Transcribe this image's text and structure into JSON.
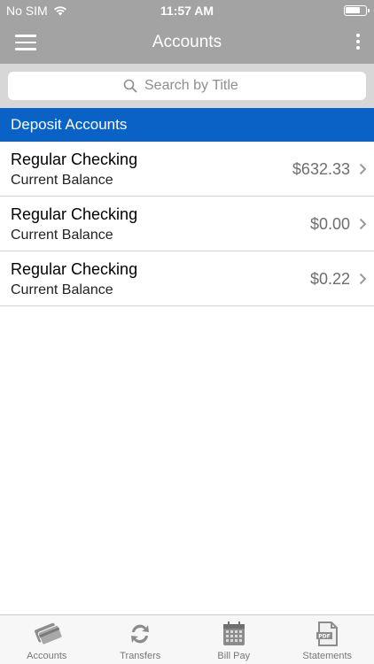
{
  "status_bar": {
    "carrier": "No SIM",
    "time": "11:57 AM"
  },
  "nav": {
    "title": "Accounts",
    "menu_icon": "hamburger-icon",
    "more_icon": "more-vertical-icon"
  },
  "search": {
    "placeholder": "Search by Title",
    "value": ""
  },
  "section": {
    "title": "Deposit Accounts"
  },
  "accounts": [
    {
      "name": "Regular Checking",
      "label": "Current Balance",
      "amount": "$632.33"
    },
    {
      "name": "Regular Checking",
      "label": "Current Balance",
      "amount": "$0.00"
    },
    {
      "name": "Regular Checking",
      "label": "Current Balance",
      "amount": "$0.22"
    }
  ],
  "tabs": [
    {
      "label": "Accounts",
      "icon": "cards-icon"
    },
    {
      "label": "Transfers",
      "icon": "transfer-arrows-icon"
    },
    {
      "label": "Bill Pay",
      "icon": "calendar-icon"
    },
    {
      "label": "Statements",
      "icon": "pdf-document-icon"
    }
  ],
  "colors": {
    "header_bg": "#a3a3a3",
    "section_bg": "#0a62c6",
    "search_bar_bg": "#d7d7d7"
  }
}
